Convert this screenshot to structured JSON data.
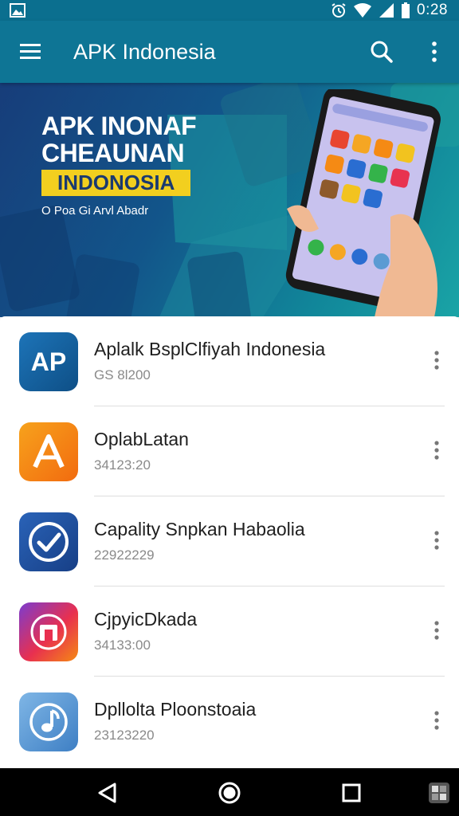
{
  "status_bar": {
    "time": "0:28",
    "icons": [
      "gallery-icon",
      "alarm-icon",
      "wifi-icon",
      "signal-icon",
      "battery-icon"
    ]
  },
  "app_bar": {
    "title": "APK Indonesia",
    "icons": [
      "menu-icon",
      "search-icon",
      "more-vert-icon"
    ]
  },
  "banner": {
    "line1": "APK INONAF",
    "line2": "CHEAUNAN",
    "badge": "INDONOSIA",
    "subtitle": "O Poa Gi Arvl Abadr"
  },
  "apps": [
    {
      "name": "Aplalk BsplClfiyah Indonesia",
      "meta": "GS 8l200"
    },
    {
      "name": "OplabLatan",
      "meta": "34123:20"
    },
    {
      "name": "Capality Snpkan Habaolia",
      "meta": "22922229"
    },
    {
      "name": "CjpyicDkada",
      "meta": "34133:00"
    },
    {
      "name": "Dpllolta Ploonstoaia",
      "meta": "23123220"
    }
  ],
  "app_icon_text": {
    "first": "AP"
  },
  "colors": {
    "primary": "#0e7595",
    "status_bar": "#0b6f8f",
    "badge": "#f2cf1f",
    "icon_blue": "#17609a",
    "icon_orange": "#f58a14",
    "icon_navy": "#1f4a9c",
    "icon_red": "#e83350",
    "icon_light_blue": "#5b9bd3"
  },
  "nav_bar": {
    "icons": [
      "back-icon",
      "home-icon",
      "recents-icon",
      "screenshot-icon"
    ]
  }
}
